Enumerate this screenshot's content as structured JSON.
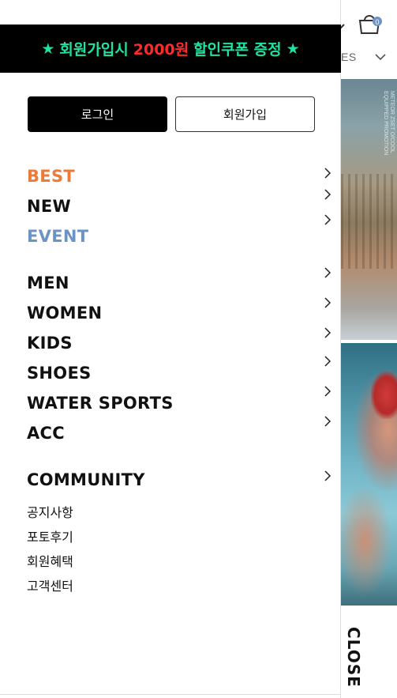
{
  "promo": {
    "star_left": "★",
    "text_prefix": "회원가입시",
    "text_amount": "2000원",
    "text_suffix": "할인쿠폰 증정",
    "star_right": "★",
    "colors": {
      "green": "#20e3a0",
      "red": "#ff2a2a"
    }
  },
  "auth": {
    "login_label": "로그인",
    "signup_label": "회원가입"
  },
  "menu_primary": [
    {
      "label": "BEST",
      "color": "#ee7a3a"
    },
    {
      "label": "NEW",
      "color": "#111111"
    },
    {
      "label": "EVENT",
      "color": "#6b93c4"
    }
  ],
  "menu_categories": [
    {
      "label": "MEN"
    },
    {
      "label": "WOMEN"
    },
    {
      "label": "KIDS"
    },
    {
      "label": "SHOES"
    },
    {
      "label": "WATER SPORTS"
    },
    {
      "label": "ACC"
    }
  ],
  "community": {
    "label": "COMMUNITY",
    "items": [
      "공지사항",
      "포토후기",
      "회원혜택",
      "고객센터"
    ]
  },
  "background": {
    "menu_text": "ES",
    "cart_count": "0",
    "photo_caption": "METEOR ZSET O/COOL EQUIPPED PROMOTION"
  },
  "close_label": "CLOSE"
}
